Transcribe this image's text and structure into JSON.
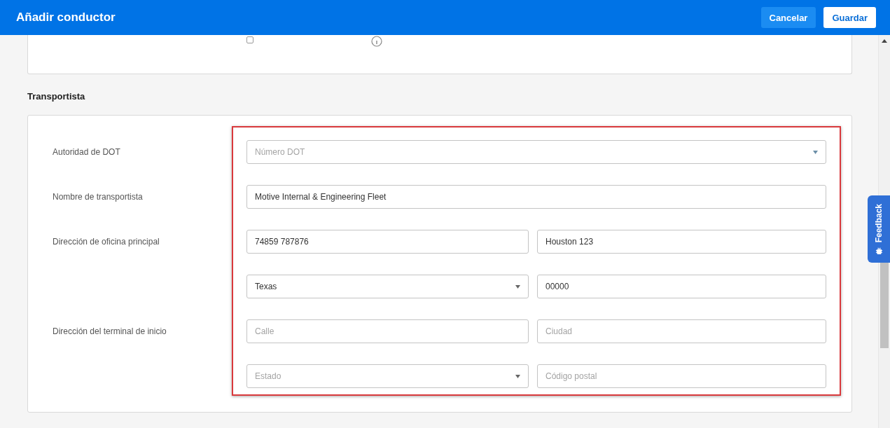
{
  "header": {
    "title": "Añadir conductor",
    "buttons": [
      {
        "label": "Cancelar",
        "kind": "secondary"
      },
      {
        "label": "Guardar",
        "kind": "primary"
      }
    ]
  },
  "top_card": {
    "checkbox": {
      "checked": false
    }
  },
  "section": {
    "title": "Transportista",
    "rows": [
      {
        "label": "Autoridad de DOT",
        "fields": [
          {
            "kind": "select",
            "placeholder": "Número DOT"
          }
        ]
      },
      {
        "label": "Nombre de transportista",
        "fields": [
          {
            "kind": "text",
            "value": "Motive Internal & Engineering Fleet"
          }
        ]
      },
      {
        "label": "Dirección de oficina principal",
        "fields": [
          {
            "kind": "text",
            "value": "74859 787876"
          },
          {
            "kind": "text",
            "value": "Houston 123"
          }
        ]
      },
      {
        "fields": [
          {
            "kind": "select",
            "value": "Texas"
          },
          {
            "kind": "text",
            "value": "00000"
          }
        ]
      },
      {
        "label": "Dirección del terminal de inicio",
        "fields": [
          {
            "kind": "text",
            "placeholder": "Calle"
          },
          {
            "kind": "text",
            "placeholder": "Ciudad"
          }
        ]
      },
      {
        "fields": [
          {
            "kind": "select",
            "placeholder": "Estado"
          },
          {
            "kind": "text",
            "placeholder": "Código postal"
          }
        ]
      }
    ]
  },
  "feedback_tab": {
    "label": "Feedback"
  }
}
